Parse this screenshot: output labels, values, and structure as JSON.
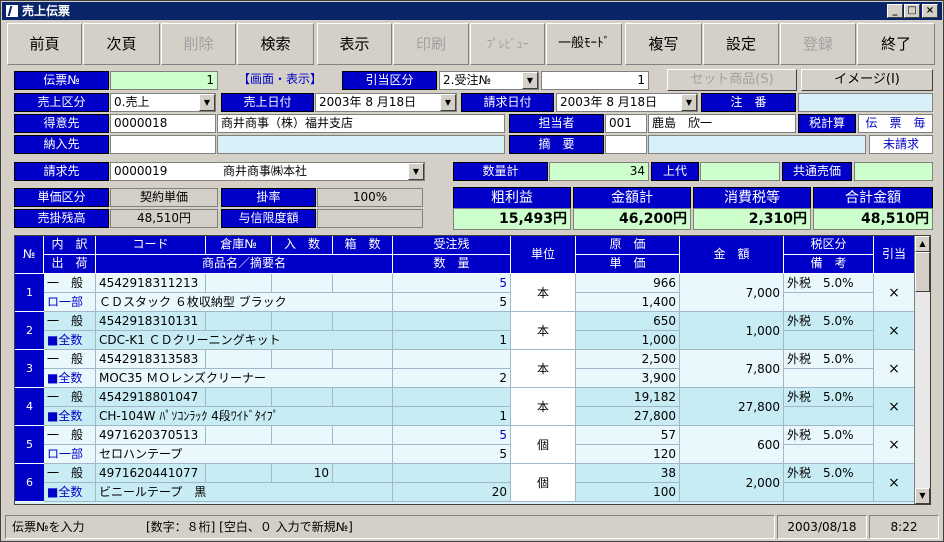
{
  "window": {
    "title": "売上伝票",
    "btn_min": "_",
    "btn_max": "□",
    "btn_close": "×"
  },
  "toolbar": {
    "buttons": [
      {
        "label": "前頁",
        "enabled": true
      },
      {
        "label": "次頁",
        "enabled": true
      },
      {
        "label": "削除",
        "enabled": false
      },
      {
        "label": "検索",
        "enabled": true
      },
      {
        "label": "表示",
        "enabled": true
      },
      {
        "label": "印刷",
        "enabled": false
      },
      {
        "label": "ﾌﾟﾚﾋﾞｭｰ",
        "enabled": false
      },
      {
        "label": "一般ﾓｰﾄﾞ",
        "enabled": true
      },
      {
        "label": "複写",
        "enabled": true
      },
      {
        "label": "設定",
        "enabled": true
      },
      {
        "label": "登録",
        "enabled": false
      },
      {
        "label": "終了",
        "enabled": true
      }
    ]
  },
  "header": {
    "denpyo_no_label": "伝票№",
    "denpyo_no": "1",
    "screen_mode": "【画面・表示】",
    "hikiate_label": "引当区分",
    "hikiate_value": "2.受注№",
    "hikiate_no": "1",
    "set_button": "セット商品(S)",
    "image_button": "イメージ(I)",
    "uriage_kubun_label": "売上区分",
    "uriage_kubun": "0.売上",
    "uriage_date_label": "売上日付",
    "uriage_date": "2003年 8 月18日",
    "seikyu_date_label": "請求日付",
    "seikyu_date": "2003年 8 月18日",
    "chuban_label": "注　番",
    "chuban": "",
    "tokuisaki_label": "得意先",
    "tokuisaki_code": "0000018",
    "tokuisaki_name": "商井商事（株）福井支店",
    "tanto_label": "担当者",
    "tanto_code": "001",
    "tanto_name": "鹿島　欣一",
    "zeikeisan_label": "税計算",
    "zeikeisan": "伝　票　毎",
    "nonyu_label": "納入先",
    "nonyu": "",
    "tekiyo_label": "摘　要",
    "tekiyo": "",
    "miseikyu": "未請求",
    "seikyusaki_label": "請求先",
    "seikyusaki_code": "0000019",
    "seikyusaki_name": "商井商事㈱本社",
    "suryokei_label": "数量計",
    "suryokei": "34",
    "jodai_label": "上代",
    "jodai": "",
    "kyotsu_label": "共通売価",
    "kyotsu": "",
    "tanka_kubun_label": "単価区分",
    "tanka_kubun": "契約単価",
    "kakeritsu_label": "掛率",
    "kakeritsu": "100%",
    "urikake_label": "売掛残高",
    "urikake": "48,510円",
    "yoshin_label": "与信限度額",
    "yoshin": "",
    "arari_label": "粗利益",
    "arari": "15,493円",
    "kingaku_label": "金額計",
    "kingaku": "46,200円",
    "shohizei_label": "消費税等",
    "shohizei": "2,310円",
    "gokei_label": "合計金額",
    "gokei": "48,510円"
  },
  "grid": {
    "headers": {
      "no": "№",
      "uchiwake": "内　訳",
      "shukka": "出　荷",
      "code": "コード",
      "soko": "倉庫№",
      "irisu": "入　数",
      "hakosu": "箱　数",
      "shohin": "商品名／摘要名",
      "juchuzan": "受注残",
      "suryo": "数　量",
      "tani": "単位",
      "genka": "原　価",
      "tanka": "単　価",
      "kingaku": "金　額",
      "zeikubun": "税区分",
      "biko": "備　考",
      "hikiate": "引当"
    },
    "rows": [
      {
        "no": "1",
        "uchiwake": "一　般",
        "shukka": "ロ一部",
        "code": "4542918311213",
        "soko": "",
        "irisu": "",
        "hakosu": "",
        "name": "ＣＤスタック ６枚収納型 ブラック",
        "juchuzan": "5",
        "suryo": "5",
        "tani": "本",
        "genka": "966",
        "tanka": "1,400",
        "kingaku": "7,000",
        "zei": "外税　5.0%",
        "biko": "",
        "hikiate": "×"
      },
      {
        "no": "2",
        "uchiwake": "一　般",
        "shukka": "■全数",
        "code": "4542918310131",
        "soko": "",
        "irisu": "",
        "hakosu": "",
        "name": "CDC-K1 ＣＤクリーニングキット",
        "juchuzan": "",
        "suryo": "1",
        "tani": "本",
        "genka": "650",
        "tanka": "1,000",
        "kingaku": "1,000",
        "zei": "外税　5.0%",
        "biko": "",
        "hikiate": "×"
      },
      {
        "no": "3",
        "uchiwake": "一　般",
        "shukka": "■全数",
        "code": "4542918313583",
        "soko": "",
        "irisu": "",
        "hakosu": "",
        "name": "MOC35 ＭＯレンズクリーナー",
        "juchuzan": "",
        "suryo": "2",
        "tani": "本",
        "genka": "2,500",
        "tanka": "3,900",
        "kingaku": "7,800",
        "zei": "外税　5.0%",
        "biko": "",
        "hikiate": "×"
      },
      {
        "no": "4",
        "uchiwake": "一　般",
        "shukka": "■全数",
        "code": "4542918801047",
        "soko": "",
        "irisu": "",
        "hakosu": "",
        "name": "CH-104W ﾊﾟｿｺﾝﾗｯｸ 4段ﾜｲﾄﾞﾀｲﾌﾟ",
        "juchuzan": "",
        "suryo": "1",
        "tani": "本",
        "genka": "19,182",
        "tanka": "27,800",
        "kingaku": "27,800",
        "zei": "外税　5.0%",
        "biko": "",
        "hikiate": "×"
      },
      {
        "no": "5",
        "uchiwake": "一　般",
        "shukka": "ロ一部",
        "code": "4971620370513",
        "soko": "",
        "irisu": "",
        "hakosu": "",
        "name": "セロハンテープ",
        "juchuzan": "5",
        "suryo": "5",
        "tani": "個",
        "genka": "57",
        "tanka": "120",
        "kingaku": "600",
        "zei": "外税　5.0%",
        "biko": "",
        "hikiate": "×"
      },
      {
        "no": "6",
        "uchiwake": "一　般",
        "shukka": "■全数",
        "code": "4971620441077",
        "soko": "",
        "irisu": "10",
        "hakosu": "",
        "name": "ビニールテープ　黒",
        "juchuzan": "",
        "suryo": "20",
        "tani": "個",
        "genka": "38",
        "tanka": "100",
        "kingaku": "2,000",
        "zei": "外税　5.0%",
        "biko": "",
        "hikiate": "×"
      }
    ]
  },
  "status": {
    "message": "伝票№を入力",
    "hint": "[数字：８桁] [空白、０ 入力で新規№]",
    "date": "2003/08/18",
    "time": "8:22"
  }
}
